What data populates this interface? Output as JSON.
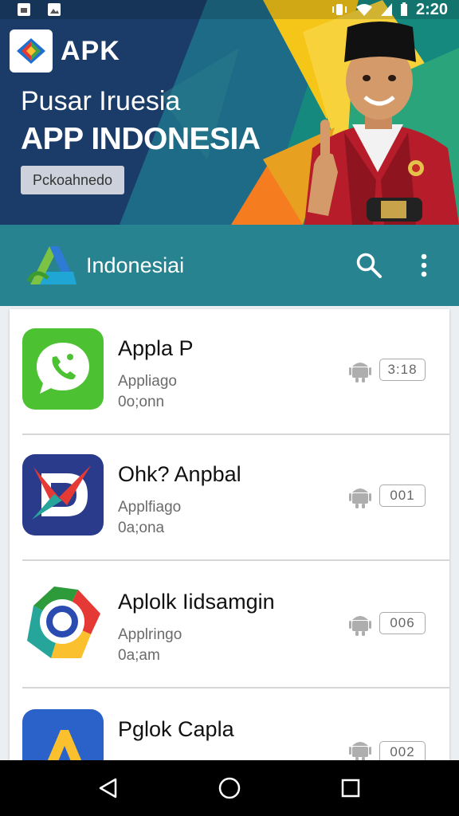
{
  "status_bar": {
    "time": "2:20"
  },
  "banner": {
    "brand": "APK",
    "subtitle": "Pusar Iruesia",
    "title": "APP INDONESIA",
    "button_label": "Pckoahnedo"
  },
  "app_bar": {
    "title": "Indonesiai"
  },
  "apps": [
    {
      "name": "Appla P",
      "category": "Appliago",
      "sub": "0o;onn",
      "version": "3:18"
    },
    {
      "name": "Ohk? Anpbal",
      "category": "Applfiago",
      "sub": "0a;ona",
      "version": "001"
    },
    {
      "name": "Aplolk Iidsamgin",
      "category": "Applringo",
      "sub": "0a;am",
      "version": "006"
    },
    {
      "name": "Pglok Capla",
      "category": "",
      "sub": "",
      "version": "002"
    }
  ],
  "colors": {
    "app_bar": "#26838f",
    "banner_bg": "#1d3f6e",
    "accent_green": "#4caf50"
  }
}
